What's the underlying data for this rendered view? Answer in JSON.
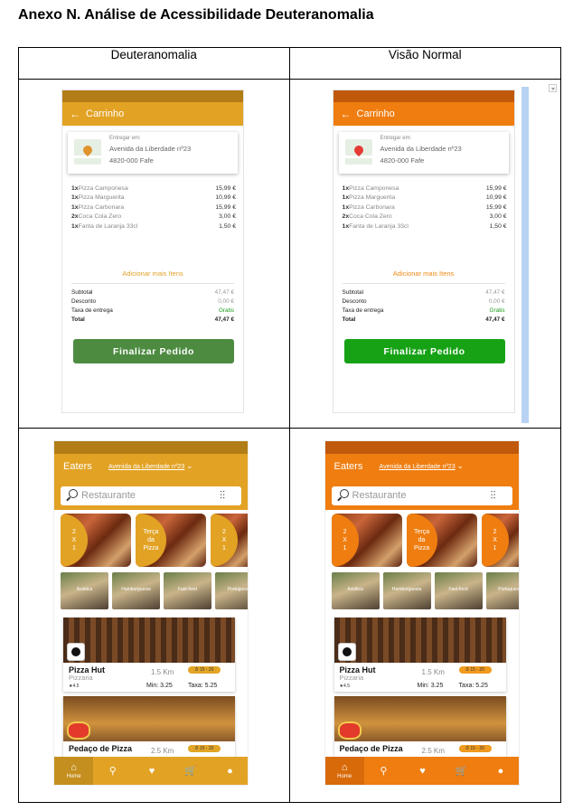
{
  "document": {
    "title": "Anexo N. Análise de Acessibilidade Deuteranomalia"
  },
  "columns": [
    "Deuteranomalia",
    "Visão Normal"
  ],
  "themes": {
    "deut": {
      "status": "#b27d16",
      "primary": "#e2a224",
      "button": "#4d8b41",
      "accent": "#e0a128",
      "time_badge": "#e3a526",
      "pin": "#e0922c",
      "nav_active": "#c48f1e"
    },
    "normal": {
      "status": "#c0590b",
      "primary": "#ef7d10",
      "button": "#17a216",
      "accent": "#ef8a14",
      "time_badge": "#f09a1e",
      "pin": "#e53935",
      "nav_active": "#d86a0a"
    }
  },
  "cart": {
    "title": "Carrinho",
    "back_icon": "arrow-left-icon",
    "delivery": {
      "label": "Entregar em:",
      "line1": "Avenida da Liberdade nº23",
      "line2": "4820-000 Fafe"
    },
    "items": [
      {
        "qty": "1x",
        "name": "Pizza Camponesa",
        "price": "15,99 €"
      },
      {
        "qty": "1x",
        "name": "Pizza Marguerita",
        "price": "10,99 €"
      },
      {
        "qty": "1x",
        "name": "Pizza Carbonara",
        "price": "15,99 €"
      },
      {
        "qty": "2x",
        "name": "Coca Cola Zero",
        "price": "3,00 €"
      },
      {
        "qty": "1x",
        "name": "Fanta de Laranja 33cl",
        "price": "1,50 €"
      }
    ],
    "add_more": "Adicionar mais Itens",
    "totals": [
      {
        "label": "Subtotal",
        "value": "47,47 €"
      },
      {
        "label": "Desconto",
        "value": "0,00 €"
      },
      {
        "label": "Taxa de entrega",
        "value": "Gratis"
      },
      {
        "label": "Total",
        "value": "47,47 €"
      }
    ],
    "finish_button": "Finalizar Pedido"
  },
  "home": {
    "brand": "Eaters",
    "location": "Avenida da Liberdade nº23",
    "search_placeholder": "Restaurante",
    "promos": [
      {
        "text": "2\nX\n1"
      },
      {
        "text": "Terça\nda\nPizza"
      },
      {
        "text": "2\nX\n1"
      }
    ],
    "categories": [
      "Asiática",
      "Hamburguesia",
      "Fast-food",
      "Portuguesa"
    ],
    "restaurants": [
      {
        "name": "Pizza Hut",
        "category": "Pizzaria",
        "distance": "1.5 Km",
        "time": "⏱ 15 - 20",
        "rating": "★4.5",
        "min": "Min: 3.25",
        "fee": "Taxa: 5.25"
      },
      {
        "name": "Pedaço de Pizza",
        "category": "",
        "distance": "2.5 Km",
        "time": "⏱ 15 - 20",
        "rating": "",
        "min": "",
        "fee": ""
      }
    ],
    "nav": [
      {
        "icon": "home-icon",
        "glyph": "⌂",
        "label": "Home"
      },
      {
        "icon": "search-icon",
        "glyph": "⚲",
        "label": ""
      },
      {
        "icon": "heart-icon",
        "glyph": "♥",
        "label": ""
      },
      {
        "icon": "cart-icon",
        "glyph": "🛒",
        "label": ""
      },
      {
        "icon": "account-icon",
        "glyph": "●",
        "label": ""
      }
    ]
  }
}
